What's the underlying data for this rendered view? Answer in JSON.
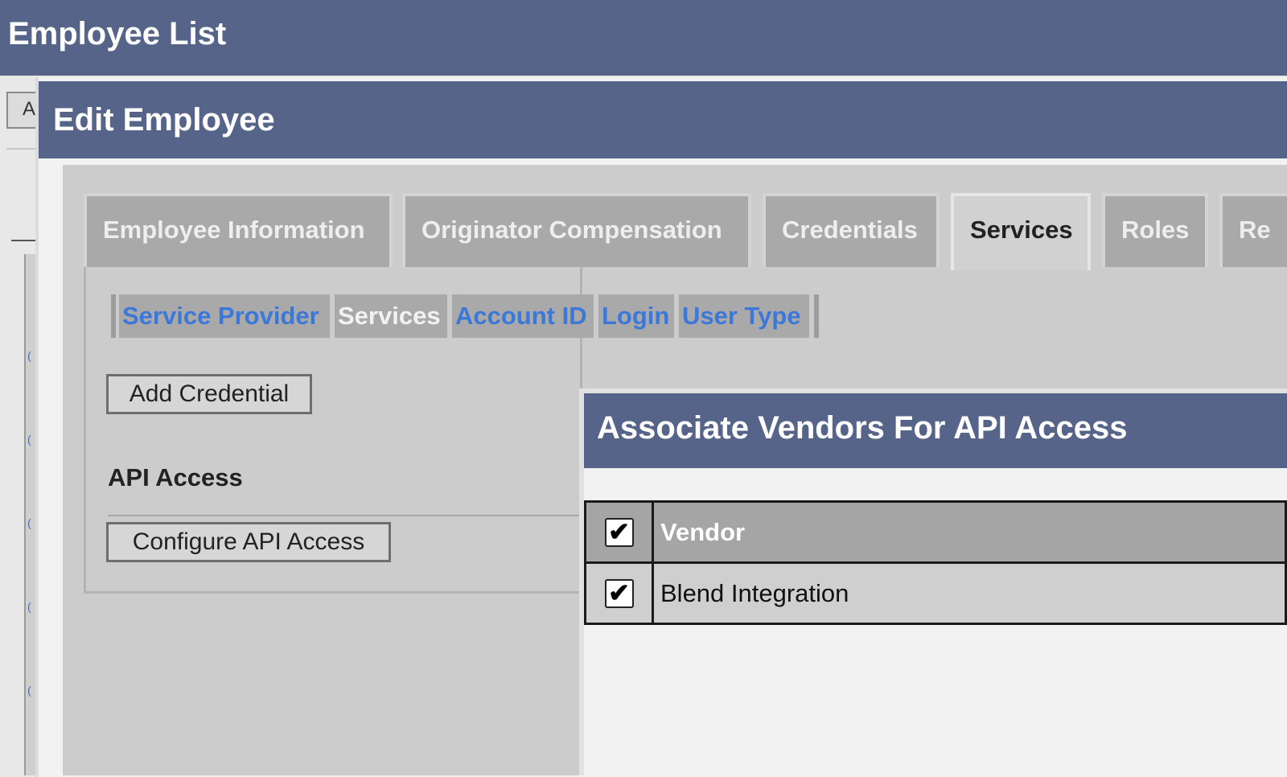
{
  "outer_window": {
    "title": "Employee List",
    "button_fragment": "A"
  },
  "edit_dialog": {
    "title": "Edit Employee",
    "tabs": [
      {
        "label": "Employee Information",
        "active": false
      },
      {
        "label": "Originator Compensation",
        "active": false
      },
      {
        "label": "Credentials",
        "active": false
      },
      {
        "label": "Services",
        "active": true
      },
      {
        "label": "Roles",
        "active": false
      },
      {
        "label": "Re",
        "active": false
      }
    ],
    "grid_columns": [
      {
        "label": "Service Provider",
        "link": true
      },
      {
        "label": "Services",
        "link": false
      },
      {
        "label": "Account ID",
        "link": true
      },
      {
        "label": "Login",
        "link": true
      },
      {
        "label": "User Type",
        "link": true
      }
    ],
    "add_credential_label": "Add Credential",
    "api_access_label": "API Access",
    "configure_api_label": "Configure API Access"
  },
  "vendor_dialog": {
    "title": "Associate Vendors For API Access",
    "header": {
      "column_label": "Vendor",
      "checked": true
    },
    "rows": [
      {
        "vendor": "Blend Integration",
        "checked": true
      }
    ]
  },
  "icons": {
    "checkmark_glyph": "✔"
  },
  "colors": {
    "title_bar": "#56648a",
    "link_blue": "#3c78d8",
    "tab_inactive": "#a9a9a9",
    "tab_active": "#d1d1d1",
    "content_bg": "#cccccc"
  }
}
